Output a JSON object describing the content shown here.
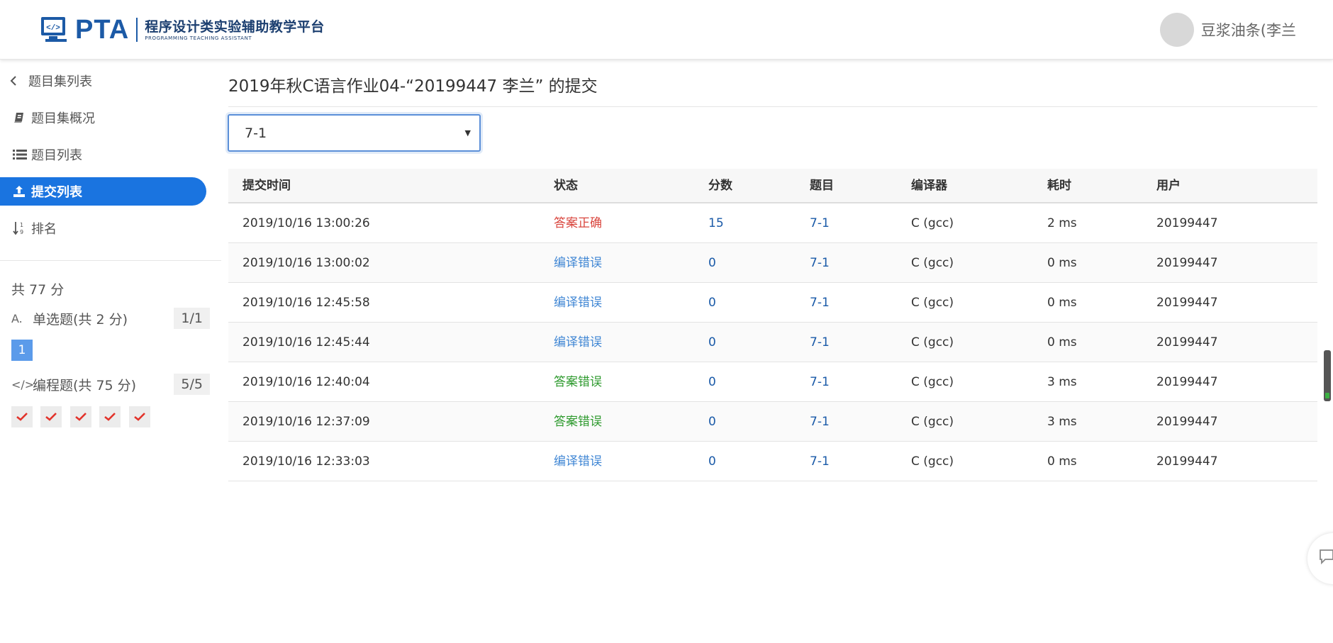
{
  "header": {
    "logo_word": "PTA",
    "logo_cn": "程序设计类实验辅助教学平台",
    "logo_en": "PROGRAMMING TEACHING ASSISTANT",
    "user_name": "豆浆油条(李兰"
  },
  "sidebar": {
    "back_label": "题目集列表",
    "items": [
      {
        "label": "题目集概况",
        "icon": "book-icon"
      },
      {
        "label": "题目列表",
        "icon": "list-icon"
      },
      {
        "label": "提交列表",
        "icon": "upload-icon",
        "active": true
      },
      {
        "label": "排名",
        "icon": "sort-icon"
      }
    ],
    "total": "共 77 分",
    "sections": [
      {
        "title": "单选题(共 2 分)",
        "icon_text": "A.",
        "count": "1/1",
        "questions": [
          "1"
        ]
      },
      {
        "title": "编程题(共 75 分)",
        "icon_text": "</>",
        "count": "5/5",
        "questions": [
          "✔",
          "✔",
          "✔",
          "✔",
          "✔"
        ]
      }
    ]
  },
  "main": {
    "title": "2019年秋C语言作业04-“20199447 李兰” 的提交",
    "filter_value": "7-1",
    "columns": [
      "提交时间",
      "状态",
      "分数",
      "题目",
      "编译器",
      "耗时",
      "用户"
    ],
    "rows": [
      {
        "time": "2019/10/16 13:00:26",
        "status": "答案正确",
        "status_type": "ok",
        "score": "15",
        "problem": "7-1",
        "compiler": "C (gcc)",
        "duration": "2 ms",
        "user": "20199447"
      },
      {
        "time": "2019/10/16 13:00:02",
        "status": "编译错误",
        "status_type": "ce",
        "score": "0",
        "problem": "7-1",
        "compiler": "C (gcc)",
        "duration": "0 ms",
        "user": "20199447"
      },
      {
        "time": "2019/10/16 12:45:58",
        "status": "编译错误",
        "status_type": "ce",
        "score": "0",
        "problem": "7-1",
        "compiler": "C (gcc)",
        "duration": "0 ms",
        "user": "20199447"
      },
      {
        "time": "2019/10/16 12:45:44",
        "status": "编译错误",
        "status_type": "ce",
        "score": "0",
        "problem": "7-1",
        "compiler": "C (gcc)",
        "duration": "0 ms",
        "user": "20199447"
      },
      {
        "time": "2019/10/16 12:40:04",
        "status": "答案错误",
        "status_type": "wa",
        "score": "0",
        "problem": "7-1",
        "compiler": "C (gcc)",
        "duration": "3 ms",
        "user": "20199447"
      },
      {
        "time": "2019/10/16 12:37:09",
        "status": "答案错误",
        "status_type": "wa",
        "score": "0",
        "problem": "7-1",
        "compiler": "C (gcc)",
        "duration": "3 ms",
        "user": "20199447"
      },
      {
        "time": "2019/10/16 12:33:03",
        "status": "编译错误",
        "status_type": "ce",
        "score": "0",
        "problem": "7-1",
        "compiler": "C (gcc)",
        "duration": "0 ms",
        "user": "20199447"
      }
    ]
  },
  "colors": {
    "accent": "#1a74e0",
    "brand": "#1c5aa6",
    "status_ok": "#d9453d",
    "status_ce": "#3f86d4",
    "status_wa": "#2e9a2e",
    "check": "#e2332b"
  }
}
